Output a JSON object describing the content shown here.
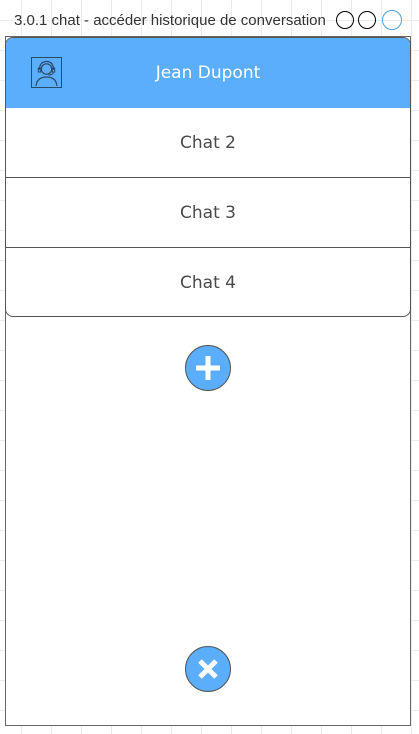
{
  "window": {
    "title": "3.0.1 chat - accéder historique de conversation"
  },
  "header": {
    "user_name": "Jean Dupont",
    "avatar_icon": "user-headset-icon"
  },
  "chats": [
    {
      "label": "Chat 2"
    },
    {
      "label": "Chat 3"
    },
    {
      "label": "Chat 4"
    }
  ],
  "actions": {
    "add_icon": "plus-icon",
    "close_icon": "close-icon"
  },
  "colors": {
    "accent": "#5aaefc",
    "text": "#4a4a4a",
    "header_text": "#ffffff"
  }
}
